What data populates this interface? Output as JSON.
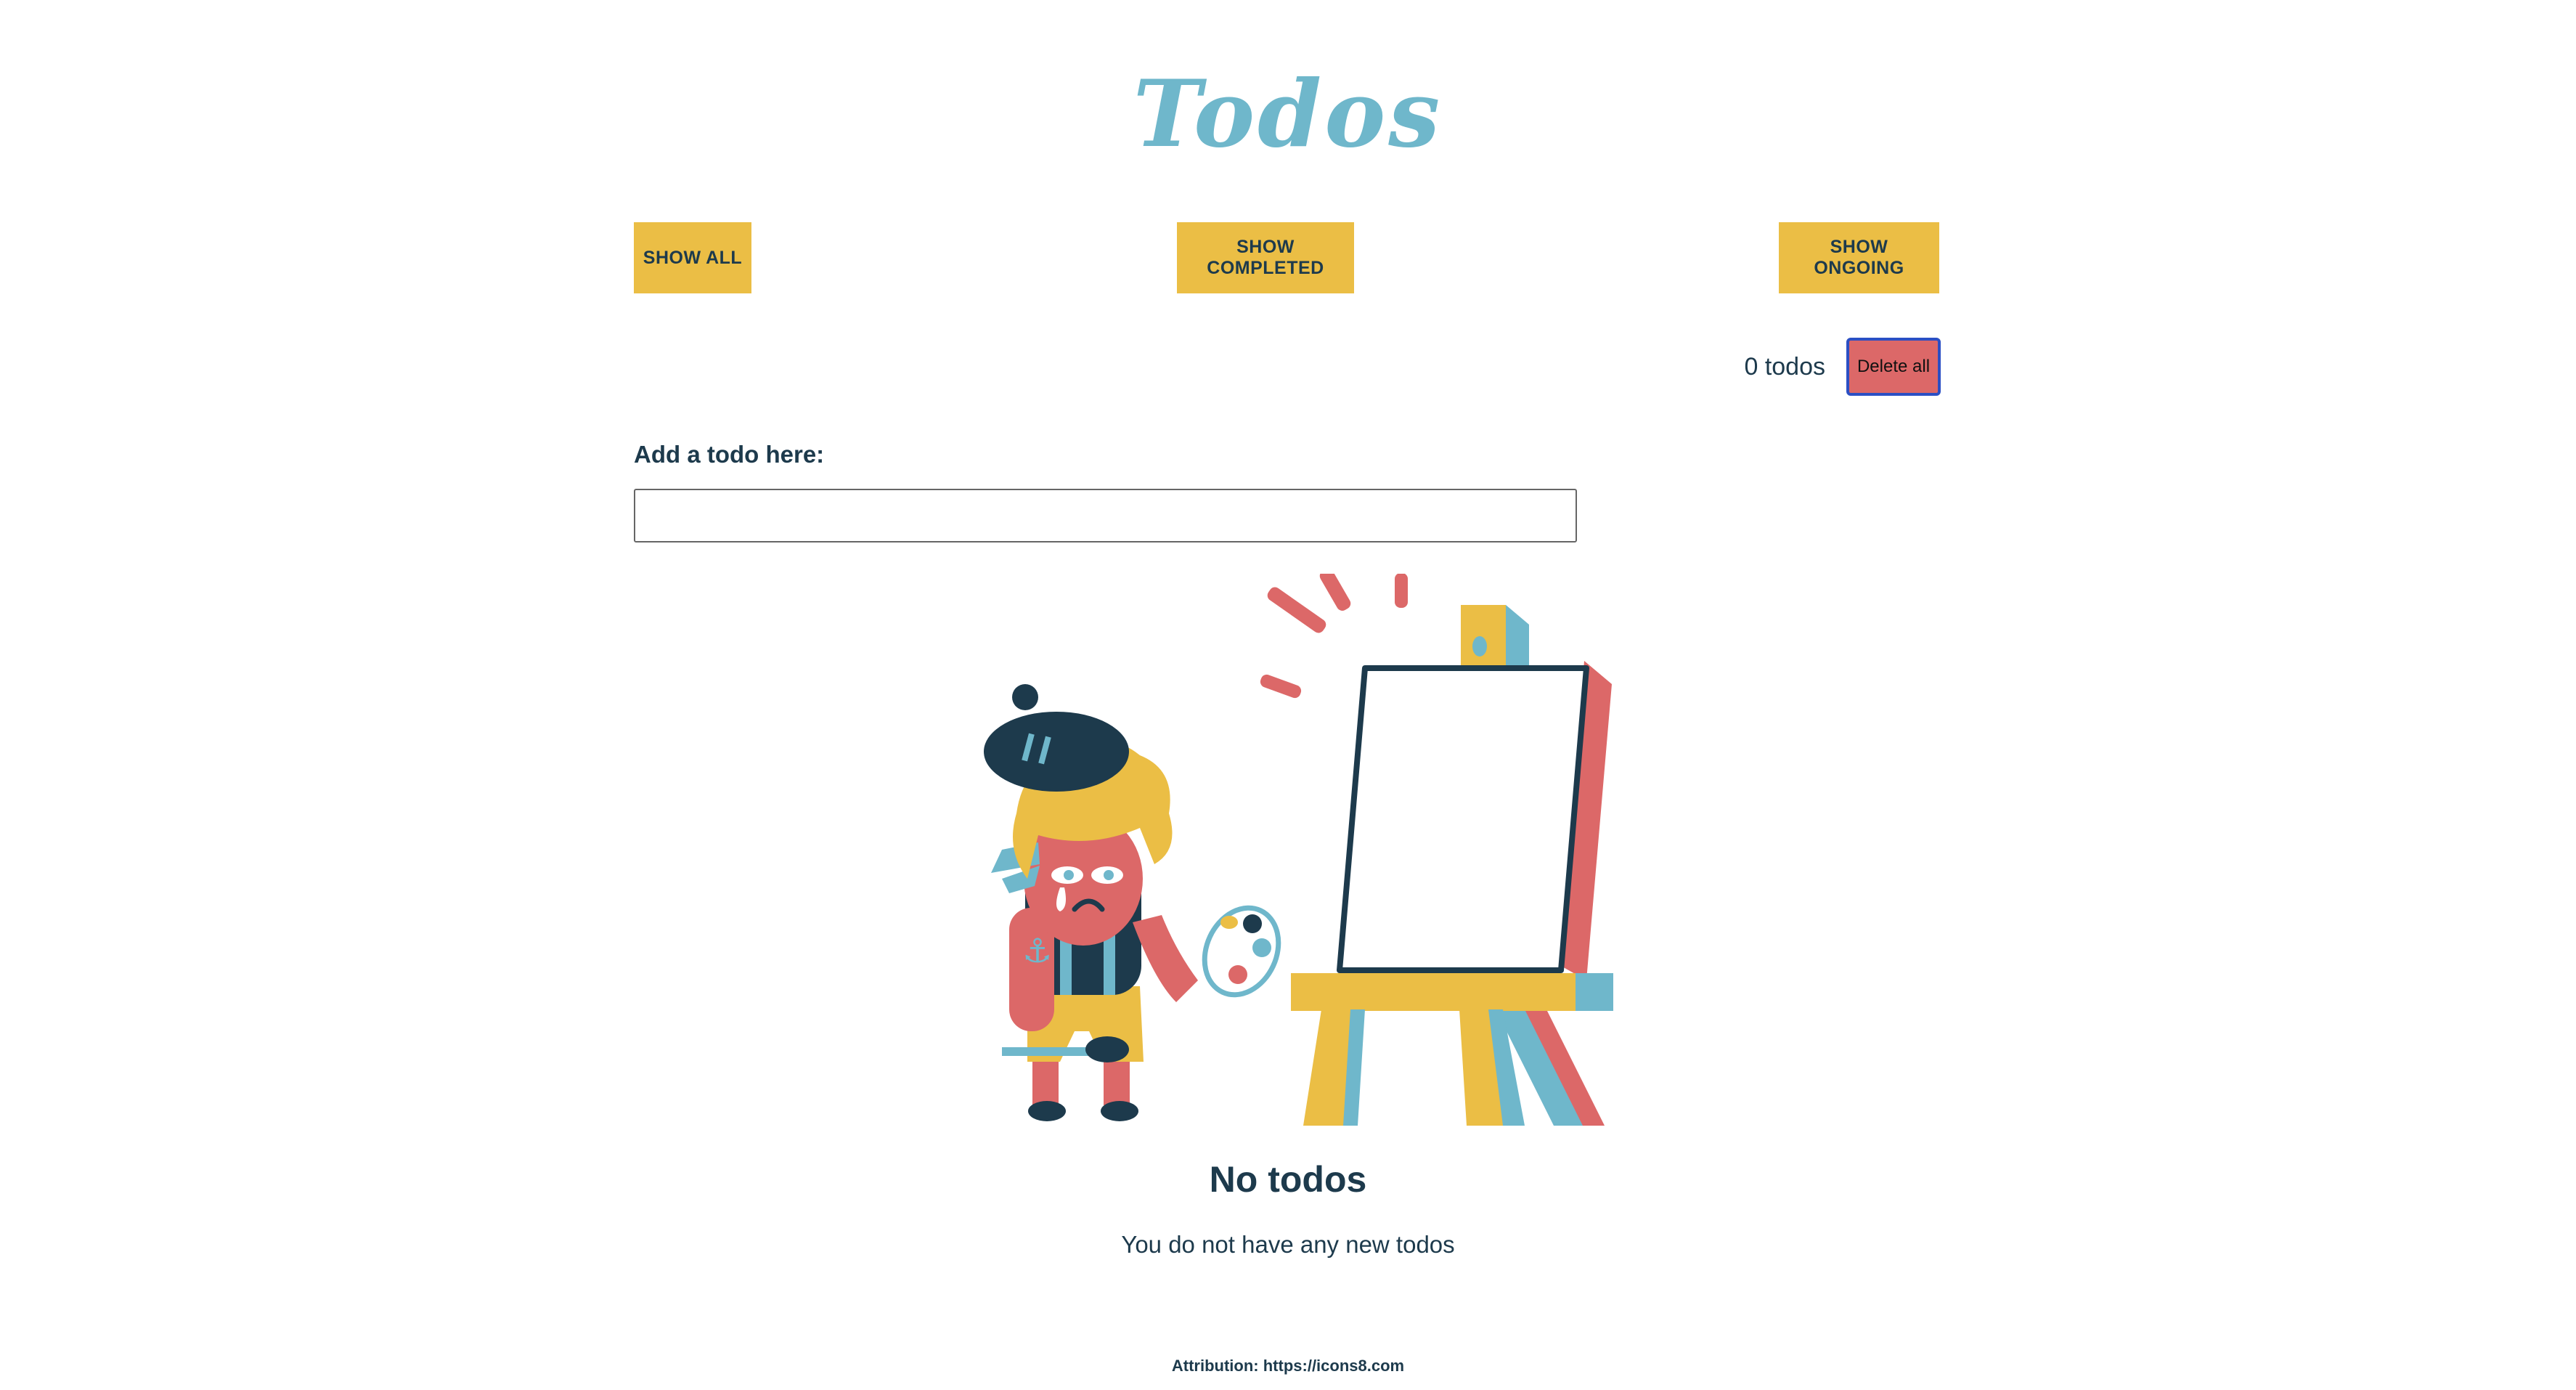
{
  "app": {
    "title": "Todos"
  },
  "filters": {
    "show_all": "SHOW ALL",
    "show_completed": "SHOW COMPLETED",
    "show_ongoing": "SHOW ONGOING"
  },
  "summary": {
    "count_text": "0 todos",
    "delete_all_label": "Delete all"
  },
  "form": {
    "label": "Add a todo here:",
    "input_value": "",
    "placeholder": ""
  },
  "empty_state": {
    "illustration": "sad-painter-at-easel-illustration",
    "title": "No todos",
    "message": "You do not have any new todos"
  },
  "footer": {
    "attribution": "Attribution: https://icons8.com"
  },
  "colors": {
    "title": "#6fb7cb",
    "button": "#ebbe45",
    "delete": "#dc6868",
    "text": "#1d3a4c",
    "delete_border": "#2b4fc4"
  }
}
